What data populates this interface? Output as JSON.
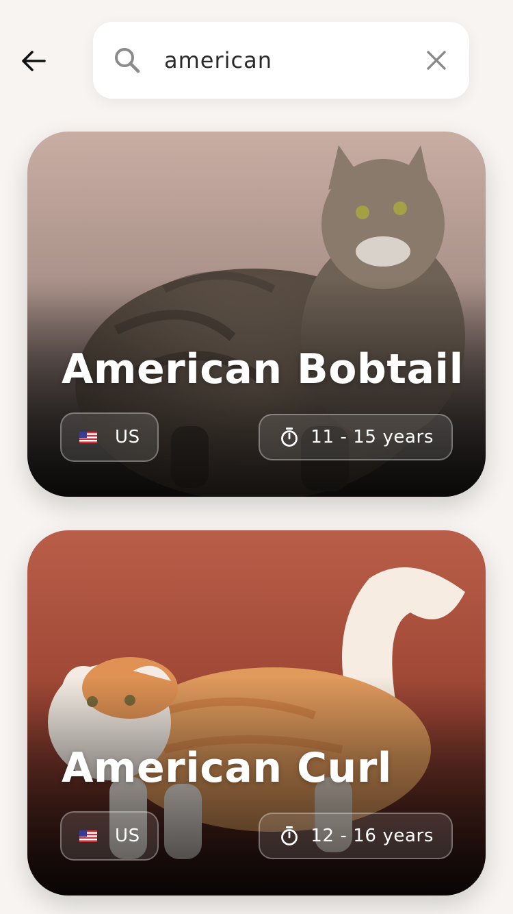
{
  "header": {
    "back_icon": "arrow-left-icon",
    "search": {
      "value": "american",
      "placeholder": "Search breeds",
      "search_icon": "search-icon",
      "clear_icon": "close-icon"
    }
  },
  "results": [
    {
      "name": "American Bobtail",
      "origin_code": "US",
      "origin_flag": "us-flag-icon",
      "life_span": "11 - 15 years",
      "life_icon": "timer-icon"
    },
    {
      "name": "American Curl",
      "origin_code": "US",
      "origin_flag": "us-flag-icon",
      "life_span": "12 - 16 years",
      "life_icon": "timer-icon"
    }
  ],
  "colors": {
    "background": "#f7f4f1",
    "search_bg": "#ffffff",
    "icon_gray": "#8a8a8a",
    "text_dark": "#2a2a2a",
    "card_text": "#ffffff"
  }
}
